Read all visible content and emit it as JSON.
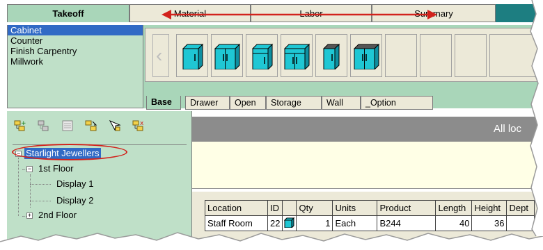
{
  "main_tabs": [
    {
      "label": "Takeoff",
      "active": true
    },
    {
      "label": "Material",
      "active": false
    },
    {
      "label": "Labor",
      "active": false
    },
    {
      "label": "Summary",
      "active": false
    }
  ],
  "categories": [
    "Cabinet",
    "Counter",
    "Finish Carpentry",
    "Millwork"
  ],
  "selected_category": "Cabinet",
  "palette_icons": [
    "base-cabinet-single-icon",
    "base-cabinet-double-icon",
    "drawer-base-cabinet-icon",
    "drawer-base-double-icon",
    "tall-cabinet-icon",
    "wide-cabinet-icon"
  ],
  "sub_tabs": [
    {
      "label": "Base",
      "active": true
    },
    {
      "label": "Drawer",
      "active": false
    },
    {
      "label": "Open",
      "active": false
    },
    {
      "label": "Storage",
      "active": false
    },
    {
      "label": "Wall",
      "active": false
    },
    {
      "label": "_Option",
      "active": false
    }
  ],
  "tree": {
    "root": "Starlight Jewellers",
    "floor1": "1st Floor",
    "display1": "Display 1",
    "display2": "Display 2",
    "floor2": "2nd Floor"
  },
  "location_header": "All loc",
  "grid": {
    "columns": [
      "Location",
      "ID",
      "",
      "Qty",
      "Units",
      "Product",
      "Length",
      "Height",
      "Dept"
    ],
    "rows": [
      {
        "location": "Staff Room",
        "id": "22",
        "qty": "1",
        "units": "Each",
        "product": "B244",
        "length": "40",
        "height": "36"
      }
    ]
  },
  "colors": {
    "panel_green": "#bfe0c8",
    "tab_green": "#a9d6b9",
    "selection_blue": "#316ac5",
    "annotation_red": "#d2221c",
    "cabinet_cyan": "#1fc7d4"
  }
}
